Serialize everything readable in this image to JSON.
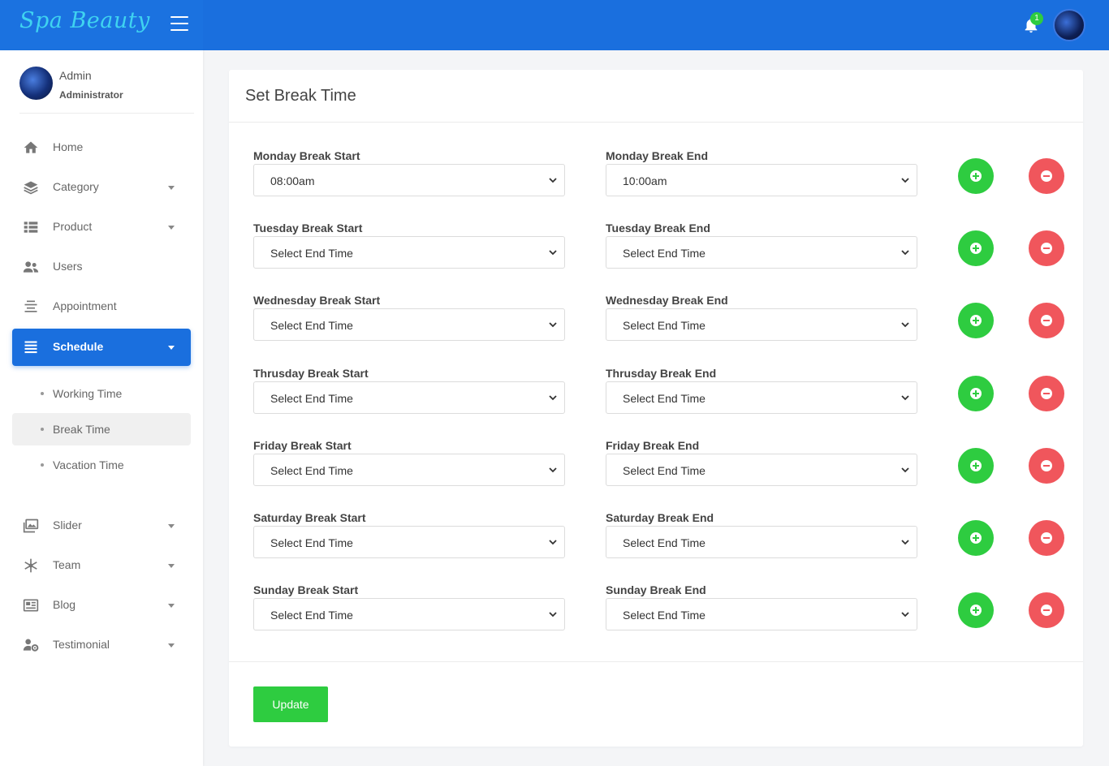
{
  "brand": {
    "name": "Spa Beauty"
  },
  "notifications": {
    "count": "1"
  },
  "profile": {
    "name": "Admin",
    "role": "Administrator"
  },
  "sidebar": {
    "items": [
      {
        "label": "Home"
      },
      {
        "label": "Category"
      },
      {
        "label": "Product"
      },
      {
        "label": "Users"
      },
      {
        "label": "Appointment"
      },
      {
        "label": "Schedule"
      },
      {
        "label": "Slider"
      },
      {
        "label": "Team"
      },
      {
        "label": "Blog"
      },
      {
        "label": "Testimonial"
      }
    ],
    "schedule_sub": [
      {
        "label": "Working Time"
      },
      {
        "label": "Break Time"
      },
      {
        "label": "Vacation Time"
      }
    ]
  },
  "card": {
    "title": "Set Break Time",
    "rows": [
      {
        "start_label": "Monday Break Start",
        "start_value": "08:00am",
        "end_label": "Monday Break End",
        "end_value": "10:00am"
      },
      {
        "start_label": "Tuesday Break Start",
        "start_value": "Select End Time",
        "end_label": "Tuesday Break End",
        "end_value": "Select End Time"
      },
      {
        "start_label": "Wednesday Break Start",
        "start_value": "Select End Time",
        "end_label": "Wednesday Break End",
        "end_value": "Select End Time"
      },
      {
        "start_label": "Thrusday Break Start",
        "start_value": "Select End Time",
        "end_label": "Thrusday Break End",
        "end_value": "Select End Time"
      },
      {
        "start_label": "Friday Break Start",
        "start_value": "Select End Time",
        "end_label": "Friday Break End",
        "end_value": "Select End Time"
      },
      {
        "start_label": "Saturday Break Start",
        "start_value": "Select End Time",
        "end_label": "Saturday Break End",
        "end_value": "Select End Time"
      },
      {
        "start_label": "Sunday Break Start",
        "start_value": "Select End Time",
        "end_label": "Sunday Break End",
        "end_value": "Select End Time"
      }
    ],
    "update_label": "Update"
  },
  "colors": {
    "primary": "#1a6fde",
    "success": "#2ecc40",
    "danger": "#f0565c"
  }
}
